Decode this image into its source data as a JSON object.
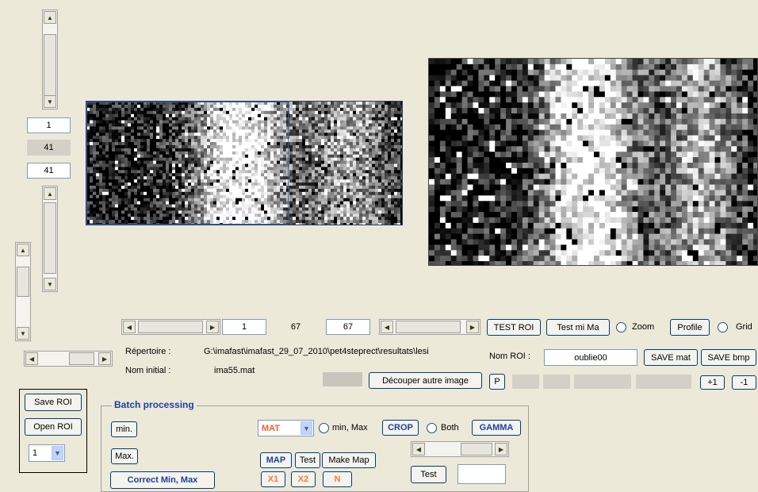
{
  "roi_controls": {
    "top_value": "1",
    "middle_value": "41",
    "bottom_value": "41"
  },
  "bottom_bar": {
    "start_value": "1",
    "span_value": "67",
    "end_value": "67",
    "test_roi_label": "TEST ROI",
    "test_mima_label": "Test mi Ma",
    "zoom_label": "Zoom",
    "profile_label": "Profile",
    "grid_label": "Grid"
  },
  "files": {
    "repertoire_label": "Répertoire :",
    "repertoire_value": "G:\\imafast\\imafast_29_07_2010\\pet4steprect\\resultats\\lesi",
    "nom_initial_label": "Nom initial :",
    "nom_initial_value": "ima55.mat",
    "decouper_label": "Découper autre image",
    "p_label": "P"
  },
  "roi_name": {
    "label": "Nom ROI :",
    "value": "oublie00",
    "save_mat_label": "SAVE mat",
    "save_bmp_label": "SAVE bmp",
    "plus_one": "+1",
    "minus_one": "-1"
  },
  "roi_file": {
    "save_label": "Save ROI",
    "open_label": "Open ROI",
    "selector_value": "1"
  },
  "batch": {
    "title": "Batch processing",
    "min_label": "min.",
    "max_label": "Max.",
    "correct_label": "Correct Min, Max",
    "format_value": "MAT",
    "minmax_label": "min, Max",
    "crop_label": "CROP",
    "both_label": "Both",
    "gamma_label": "GAMMA",
    "map_label": "MAP",
    "test_label": "Test",
    "make_map_label": "Make Map",
    "x1_label": "X1",
    "x2_label": "X2",
    "n_label": "N",
    "test2_label": "Test"
  }
}
